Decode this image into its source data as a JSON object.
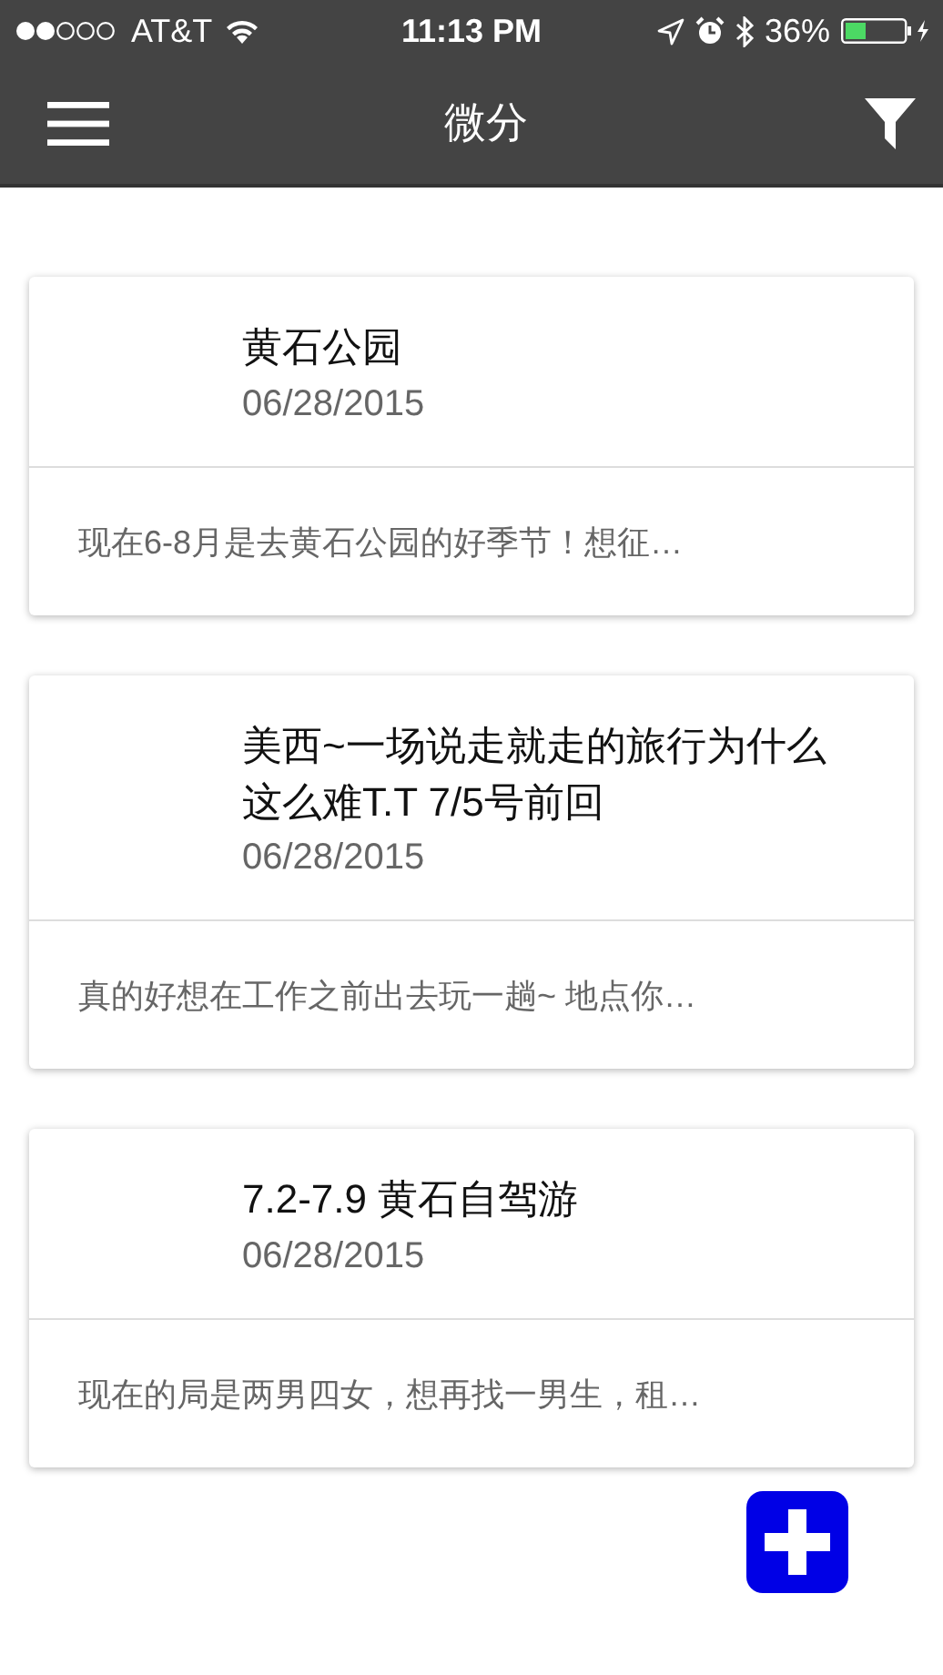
{
  "status_bar": {
    "carrier": "AT&T",
    "time": "11:13 PM",
    "battery": "36%"
  },
  "nav_bar": {
    "title": "微分"
  },
  "posts": [
    {
      "title": "黄石公园",
      "date": "06/28/2015",
      "excerpt": "现在6-8月是去黄石公园的好季节！想征…"
    },
    {
      "title": "美西~一场说走就走的旅行为什么这么难T.T 7/5号前回",
      "date": "06/28/2015",
      "excerpt": "真的好想在工作之前出去玩一趟~ 地点你…"
    },
    {
      "title": "7.2-7.9 黄石自驾游",
      "date": "06/28/2015",
      "excerpt": "现在的局是两男四女，想再找一男生，租…"
    }
  ]
}
